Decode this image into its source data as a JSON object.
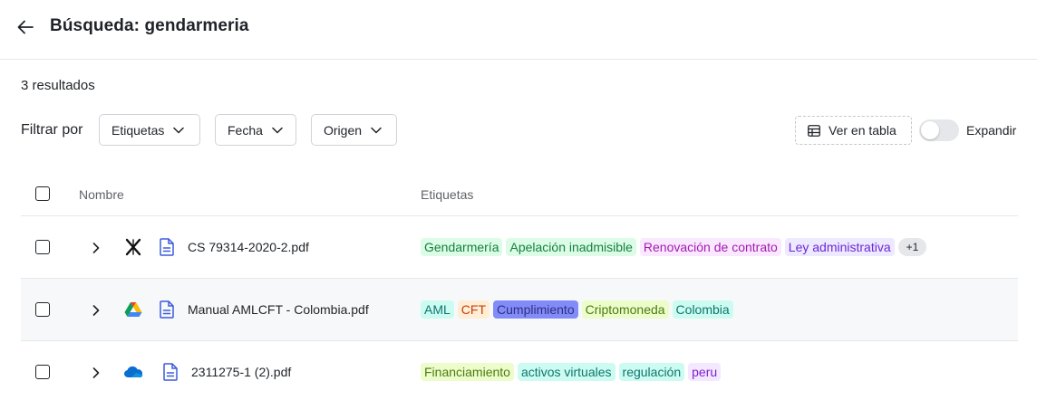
{
  "header": {
    "title": "Búsqueda: gendarmeria"
  },
  "results": {
    "count_label": "3 resultados"
  },
  "filters": {
    "label": "Filtrar por",
    "buttons": [
      {
        "label": "Etiquetas"
      },
      {
        "label": "Fecha"
      },
      {
        "label": "Origen"
      }
    ]
  },
  "view": {
    "table_button_label": "Ver en tabla",
    "expand_label": "Expandir",
    "expand_on": false
  },
  "table": {
    "columns": {
      "name": "Nombre",
      "tags": "Etiquetas"
    },
    "rows": [
      {
        "source_icon": "x-logo-icon",
        "file": "CS 79314-2020-2.pdf",
        "tags": [
          {
            "label": "Gendarmería",
            "bg": "#dcfce7",
            "fg": "#15803d"
          },
          {
            "label": "Apelación inadmisible",
            "bg": "#dcfce7",
            "fg": "#15803d"
          },
          {
            "label": "Renovación de contrato",
            "bg": "#fae8ff",
            "fg": "#a21caf"
          },
          {
            "label": "Ley administrativa",
            "bg": "#ede9fe",
            "fg": "#6d28d9"
          }
        ],
        "more": "+1"
      },
      {
        "source_icon": "google-drive-icon",
        "file": "Manual AMLCFT - Colombia.pdf",
        "tags": [
          {
            "label": "AML",
            "bg": "#ccfbf1",
            "fg": "#0f766e"
          },
          {
            "label": "CFT",
            "bg": "#ffedd5",
            "fg": "#c2410c"
          },
          {
            "label": "Cumplimiento",
            "bg": "#818cf8",
            "fg": "#312e81"
          },
          {
            "label": "Criptomoneda",
            "bg": "#ecfccb",
            "fg": "#4d7c0f"
          },
          {
            "label": "Colombia",
            "bg": "#ccfbf1",
            "fg": "#0f766e"
          }
        ],
        "more": ""
      },
      {
        "source_icon": "onedrive-icon",
        "file": "2311275-1 (2).pdf",
        "tags": [
          {
            "label": "Financiamiento",
            "bg": "#ecfccb",
            "fg": "#4d7c0f"
          },
          {
            "label": "activos virtuales",
            "bg": "#ccfbf1",
            "fg": "#0f766e"
          },
          {
            "label": "regulación",
            "bg": "#ccfbf1",
            "fg": "#0f766e"
          },
          {
            "label": "peru",
            "bg": "#f3e8ff",
            "fg": "#7e22ce"
          }
        ],
        "more": ""
      }
    ]
  }
}
